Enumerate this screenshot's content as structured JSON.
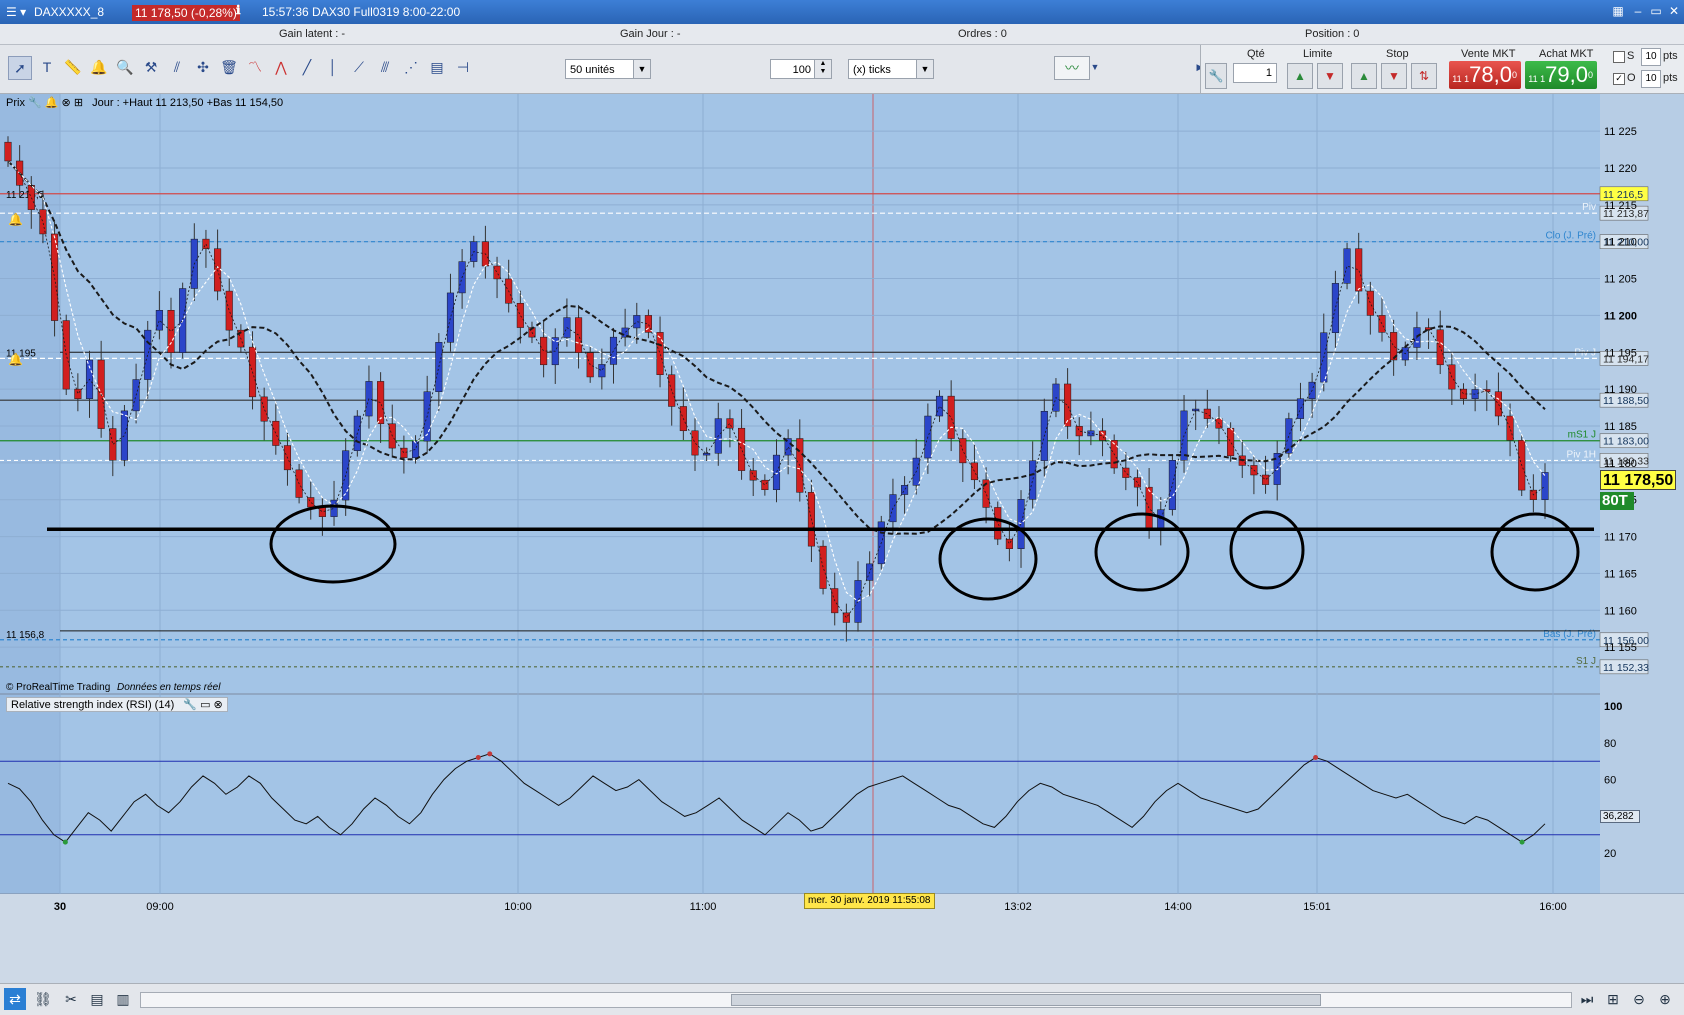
{
  "window": {
    "instrument": "DAXXXXX_8",
    "badge": "11 178,50 (-0,28%)",
    "title": "15:57:36  DAX30 Full0319 8:00-22:00"
  },
  "infobar": {
    "gain_latent": "Gain latent :  -",
    "gain_jour": "Gain Jour :  -",
    "ordres": "Ordres :  0",
    "position": "Position :  0"
  },
  "toolbar": {
    "units_select": "50 unités",
    "ticks_value": "100",
    "ticks_select": "(x) ticks"
  },
  "order_panel": {
    "qty_label": "Qté",
    "qty_value": "1",
    "limit_label": "Limite",
    "stop_label": "Stop",
    "sell_label": "Vente MKT",
    "buy_label": "Achat MKT",
    "sell_prefix": "11 1",
    "sell_price": "78,0",
    "sell_sup": "0",
    "buy_prefix": "11 1",
    "buy_price": "79,0",
    "buy_sup": "0",
    "s_label": "S",
    "o_label": "O",
    "pts_value1": "10",
    "pts_value2": "10",
    "pts_label": "pts"
  },
  "price_panel": {
    "label": "Prix",
    "legend": "Jour : +Haut 11 213,50 +Bas 11 154,50",
    "copyright": "© ProRealTime Trading",
    "realtime": "Données en temps réel",
    "current_price": "11 178,50",
    "volume_badge": "80T"
  },
  "rsi_panel": {
    "label": "Relative strength index (RSI) (14)",
    "current_value": "36,282"
  },
  "status_bar": {
    "cursor_time": "mer. 30 janv. 2019 11:55:08"
  },
  "chart_data": [
    {
      "type": "candlestick",
      "title": "DAX30 Full0319",
      "x_ticks": [
        "30",
        "09:00",
        "10:00",
        "11:00",
        "13:02",
        "14:00",
        "15:01",
        "16:00"
      ],
      "y_ticks": [
        11155,
        11160,
        11165,
        11170,
        11175,
        11180,
        11185,
        11190,
        11195,
        11200,
        11205,
        11210,
        11215,
        11220,
        11225
      ],
      "y_tick_labels": [
        "11 155",
        "11 160",
        "11 165",
        "11 170",
        "11 175",
        "11 180",
        "11 185",
        "11 190",
        "11 195",
        "11 200",
        "11 205",
        "11 210",
        "11 215",
        "11 220",
        "11 225"
      ],
      "ylim": [
        11150,
        11228
      ],
      "close_path": [
        11222,
        11218,
        11214,
        11210,
        11200,
        11190,
        11188,
        11195,
        11185,
        11180,
        11186,
        11192,
        11198,
        11200,
        11196,
        11204,
        11210,
        11208,
        11204,
        11198,
        11195,
        11190,
        11186,
        11182,
        11178,
        11176,
        11174,
        11172,
        11176,
        11182,
        11186,
        11190,
        11186,
        11182,
        11180,
        11184,
        11190,
        11196,
        11202,
        11208,
        11210,
        11206,
        11206,
        11202,
        11198,
        11196,
        11194,
        11197,
        11199,
        11196,
        11192,
        11193,
        11196,
        11199,
        11200,
        11197,
        11193,
        11188,
        11184,
        11180,
        11182,
        11186,
        11184,
        11180,
        11178,
        11176,
        11180,
        11184,
        11176,
        11168,
        11164,
        11160,
        11158,
        11163,
        11167,
        11172,
        11175,
        11178,
        11181,
        11186,
        11188,
        11184,
        11180,
        11177,
        11175,
        11170,
        11168,
        11174,
        11181,
        11187,
        11190,
        11186,
        11184,
        11184,
        11182,
        11180,
        11178,
        11176,
        11172,
        11174,
        11180,
        11186,
        11188,
        11186,
        11184,
        11182,
        11180,
        11178,
        11176,
        11182,
        11186,
        11188,
        11192,
        11198,
        11204,
        11208,
        11204,
        11200,
        11197,
        11195,
        11196,
        11198,
        11197,
        11194,
        11190,
        11188,
        11191,
        11190,
        11186,
        11182,
        11177,
        11175,
        11178
      ],
      "levels": [
        {
          "label": "11 216,5",
          "value": 11216.5
        },
        {
          "label": "11 213,87",
          "value": 11213.87,
          "tag": "Piv"
        },
        {
          "label": "11 210,00",
          "value": 11210.0,
          "tag": "Clo (J. Pré)"
        },
        {
          "label": "11 194,17",
          "value": 11194.17,
          "tag": "Piv J"
        },
        {
          "label": "11 188,50",
          "value": 11188.5
        },
        {
          "label": "11 183,00",
          "value": 11183.0,
          "tag": "mS1 J"
        },
        {
          "label": "11 180,33",
          "value": 11180.33,
          "tag": "Piv 1H"
        },
        {
          "label": "11 156,00",
          "value": 11156.0,
          "tag": "Bas (J. Pré)"
        },
        {
          "label": "11 152,33",
          "value": 11152.33,
          "tag": "S1 J"
        }
      ],
      "left_labels": [
        "11 216,5",
        "11 195",
        "11 156,8"
      ],
      "support_line": 11171,
      "annotations": [
        "ellipse",
        "ellipse",
        "ellipse",
        "ellipse",
        "ellipse"
      ]
    },
    {
      "type": "line",
      "title": "Relative strength index (RSI) (14)",
      "y_ticks": [
        20,
        40,
        60,
        80,
        100
      ],
      "ylim": [
        0,
        100
      ],
      "bands": [
        30,
        70
      ],
      "values": [
        58,
        55,
        48,
        38,
        30,
        26,
        34,
        42,
        38,
        32,
        40,
        48,
        52,
        46,
        42,
        48,
        56,
        62,
        58,
        52,
        56,
        62,
        58,
        50,
        44,
        38,
        36,
        40,
        34,
        30,
        36,
        44,
        50,
        46,
        40,
        36,
        42,
        52,
        60,
        66,
        70,
        72,
        74,
        70,
        64,
        58,
        54,
        50,
        46,
        50,
        56,
        62,
        58,
        54,
        56,
        60,
        54,
        48,
        44,
        40,
        42,
        46,
        50,
        44,
        38,
        34,
        30,
        36,
        42,
        38,
        32,
        34,
        40,
        46,
        52,
        56,
        58,
        60,
        62,
        58,
        54,
        50,
        46,
        44,
        40,
        36,
        34,
        40,
        48,
        54,
        58,
        56,
        52,
        50,
        48,
        46,
        42,
        38,
        34,
        40,
        48,
        54,
        58,
        54,
        50,
        48,
        46,
        44,
        42,
        44,
        50,
        56,
        62,
        68,
        72,
        70,
        66,
        62,
        58,
        54,
        52,
        50,
        52,
        48,
        44,
        40,
        38,
        36,
        40,
        38,
        34,
        30,
        26,
        30,
        36
      ]
    }
  ]
}
